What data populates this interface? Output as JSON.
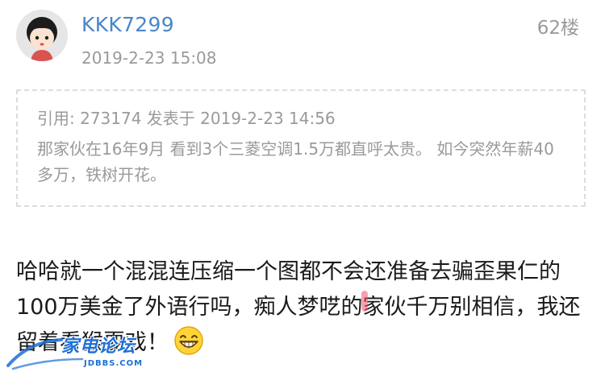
{
  "post": {
    "username": "KKK7299",
    "timestamp": "2019-2-23 15:08",
    "floor": "62楼",
    "avatar_icon": "cartoon-girl-avatar-icon"
  },
  "quote": {
    "header": "引用: 273174 发表于 2019-2-23 14:56",
    "body": "那家伙在16年9月 看到3个三菱空调1.5万都直呼太贵。 如今突然年薪40多万，铁树开花。"
  },
  "body": {
    "part1": "哈哈就一个混混连压缩一个图都不会",
    "highlight": "还准备去骗歪果仁的100万美金了外语行吗",
    "part2": "，痴人梦呓的家伙千万别相信，我还留着看猴耍戏！",
    "emoji": "laughing-emoji-icon",
    "highlight_color": "#f5506e"
  },
  "watermark": {
    "logo_text": "家电论坛",
    "site_text": "JDBBS.COM",
    "color": "#1e6fd6"
  },
  "colors": {
    "username": "#4a86c8",
    "meta": "#9a9a9a",
    "text": "#1a1a1a",
    "quote_border": "#dcdcdc"
  }
}
